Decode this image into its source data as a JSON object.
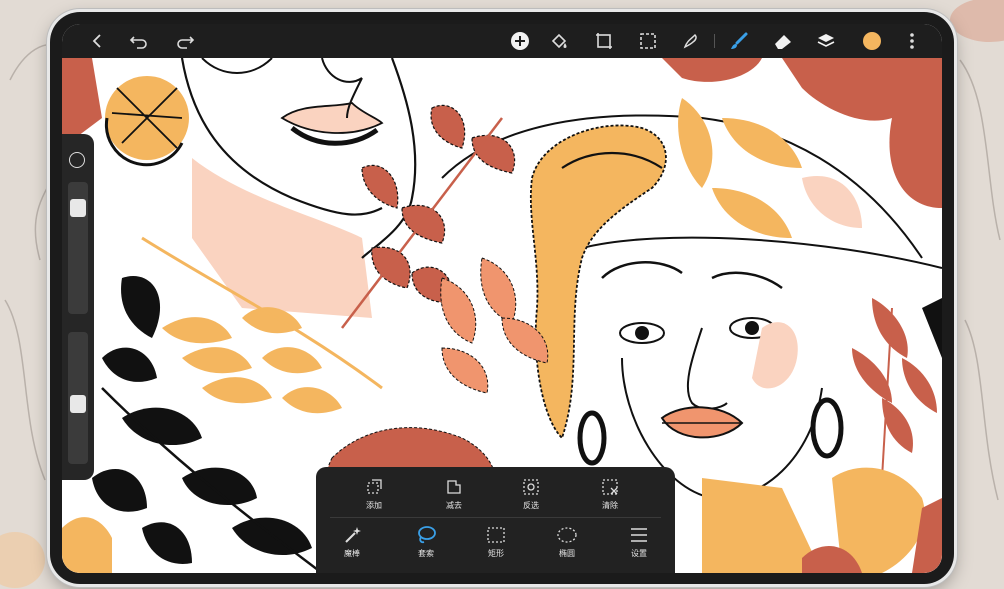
{
  "toolbar": {
    "left": [
      {
        "name": "back-icon"
      },
      {
        "name": "undo-icon"
      },
      {
        "name": "redo-icon"
      }
    ],
    "right": [
      {
        "name": "add-icon"
      },
      {
        "name": "paint-bucket-icon"
      },
      {
        "name": "transform-icon"
      },
      {
        "name": "selection-icon"
      },
      {
        "name": "smudge-icon"
      },
      {
        "name": "brush-icon"
      },
      {
        "name": "eraser-icon"
      },
      {
        "name": "layers-icon"
      },
      {
        "name": "color-swatch"
      },
      {
        "name": "more-icon"
      }
    ],
    "accent_color": "#3aa0e8",
    "current_color": "#f4b65f"
  },
  "sidebar": {
    "size_slider_level": 0.15,
    "opacity_slider_level": 0.55
  },
  "selection_panel": {
    "row1": [
      {
        "icon": "add-selection-icon",
        "label": "添加"
      },
      {
        "icon": "subtract-selection-icon",
        "label": "减去"
      },
      {
        "icon": "invert-selection-icon",
        "label": "反选"
      },
      {
        "icon": "clear-selection-icon",
        "label": "清除"
      }
    ],
    "row2": [
      {
        "icon": "magic-wand-icon",
        "label": "魔棒"
      },
      {
        "icon": "lasso-icon",
        "label": "套索",
        "active": true
      },
      {
        "icon": "rectangle-icon",
        "label": "矩形"
      },
      {
        "icon": "ellipse-icon",
        "label": "椭圆"
      },
      {
        "icon": "settings-icon",
        "label": "设置"
      }
    ]
  },
  "palette": {
    "terracotta": "#c8604b",
    "orange": "#f4b65f",
    "peach": "#fad3c0",
    "black": "#111111"
  }
}
